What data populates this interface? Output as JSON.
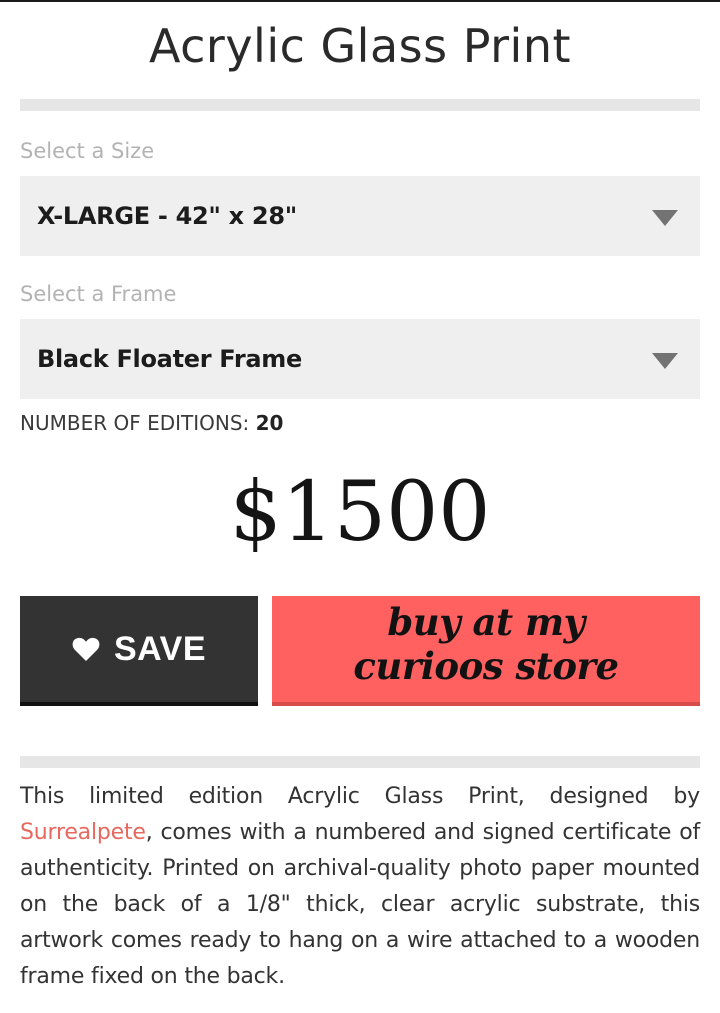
{
  "product": {
    "title": "Acrylic Glass Print"
  },
  "size": {
    "label": "Select a Size",
    "selected": "X-LARGE - 42\" x 28\""
  },
  "frame": {
    "label": "Select a Frame",
    "selected": "Black Floater Frame"
  },
  "editions": {
    "label": "NUMBER OF EDITIONS: ",
    "count": "20"
  },
  "price": "$1500",
  "actions": {
    "save_label": "SAVE",
    "save_icon": "heart-icon",
    "buy_label_line1": "buy at my",
    "buy_label_line2": "curioos store"
  },
  "description": {
    "before_link": "This limited edition Acrylic Glass Print, designed by ",
    "artist": "Surrealpete",
    "after_link": ", comes with a numbered and signed certificate of authenticity. Printed on archival-quality photo paper mounted on the back of a 1/8\" thick, clear acrylic substrate, this artwork comes ready to hang on a wire attached to a wooden frame fixed on the back."
  },
  "colors": {
    "save_button": "#333333",
    "buy_button": "#ff6161",
    "artist_link": "#e8675e",
    "select_background": "#efefef",
    "divider": "#e6e6e6"
  }
}
